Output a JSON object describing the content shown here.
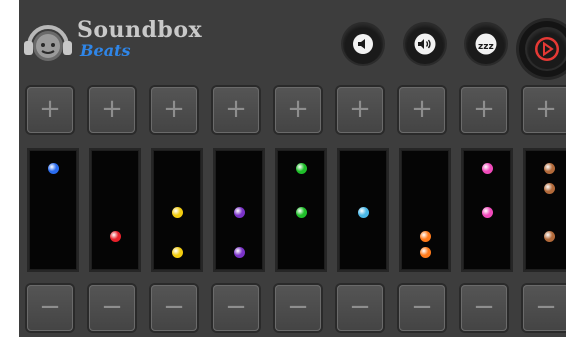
{
  "app": {
    "title": "Soundbox",
    "subtitle": "Beats"
  },
  "header": {
    "buttons": [
      {
        "name": "volume-down-icon"
      },
      {
        "name": "volume-up-icon"
      },
      {
        "name": "sleep-icon",
        "label": "zzz"
      },
      {
        "name": "play-icon",
        "color": "#e53935"
      }
    ]
  },
  "tracks": {
    "plus_symbol": "+",
    "minus_symbol": "−",
    "columns": [
      {
        "color": "#2a6cf0",
        "notes": [
          0.15
        ]
      },
      {
        "color": "#e8202a",
        "notes": [
          0.72
        ]
      },
      {
        "color": "#f2cc10",
        "notes": [
          0.52,
          0.85
        ]
      },
      {
        "color": "#7a32c8",
        "notes": [
          0.52,
          0.85
        ]
      },
      {
        "color": "#1fbf2a",
        "notes": [
          0.15,
          0.52
        ]
      },
      {
        "color": "#4ab8e8",
        "notes": [
          0.52
        ]
      },
      {
        "color": "#ff7a1a",
        "notes": [
          0.72,
          0.85
        ]
      },
      {
        "color": "#f04aba",
        "notes": [
          0.15,
          0.52
        ]
      },
      {
        "color": "#b36a3a",
        "notes": [
          0.15,
          0.32,
          0.72
        ]
      }
    ]
  }
}
